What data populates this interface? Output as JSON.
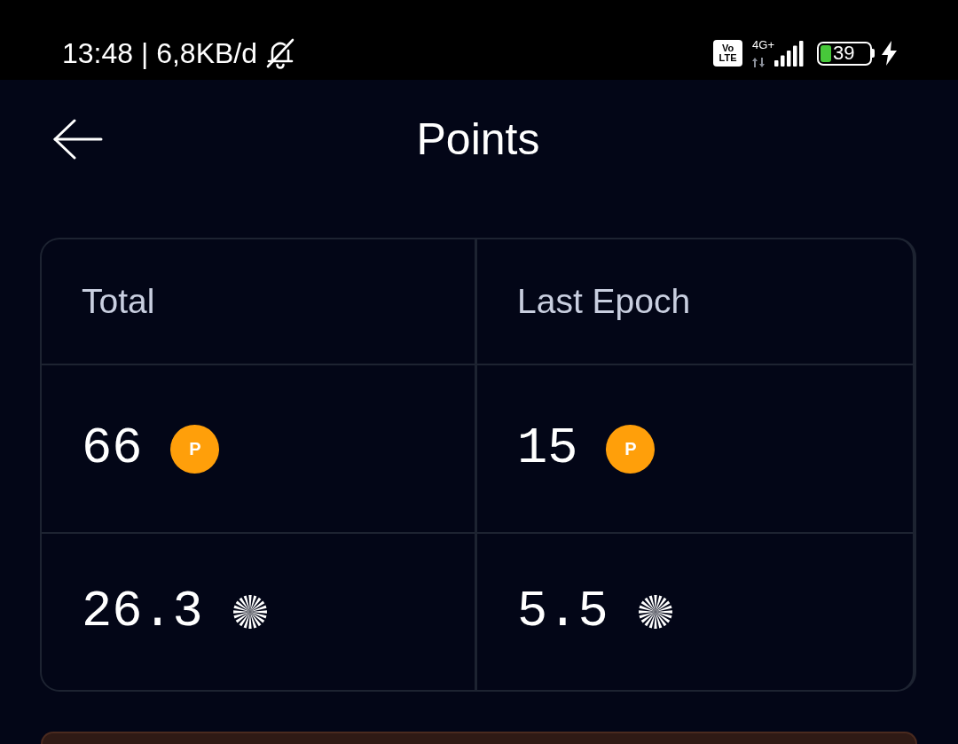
{
  "status_bar": {
    "text": "13:48 | 6,8KB/d",
    "notifications_muted": true,
    "volte_badge": [
      "Vo",
      "LTE"
    ],
    "network_type": "4G+",
    "battery_percentage": "39",
    "charging": true
  },
  "header": {
    "title": "Points"
  },
  "points_table": {
    "columns": [
      "Total",
      "Last Epoch"
    ],
    "rows": [
      {
        "cells": [
          {
            "kind": "coin",
            "value": "66",
            "badge": "P"
          },
          {
            "kind": "coin",
            "value": "15",
            "badge": "P"
          }
        ]
      },
      {
        "cells": [
          {
            "kind": "burst",
            "value": "26.3"
          },
          {
            "kind": "burst",
            "value": "5.5"
          }
        ]
      }
    ]
  }
}
